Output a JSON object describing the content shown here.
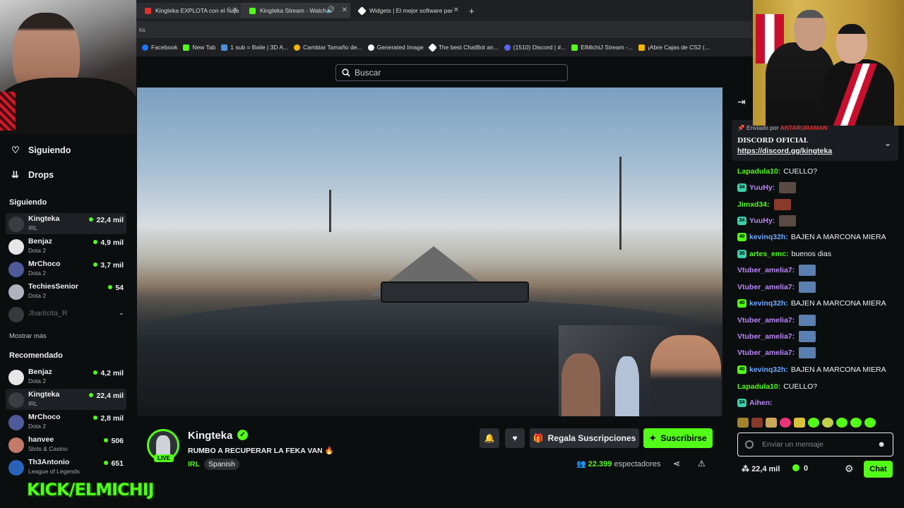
{
  "browser": {
    "tabs": [
      {
        "title": "Kingteka EXPLOTA con el Ñaja",
        "color": "#e0312d"
      },
      {
        "title": "Kingteka Stream - Watch L",
        "color": "#53fc18"
      },
      {
        "title": "Widgets | El mejor software par",
        "color": "#ffffff"
      }
    ],
    "address": "ka",
    "bookmarks": [
      {
        "label": "Facebook",
        "color": "#1877f2"
      },
      {
        "label": "New Tab",
        "color": "#53fc18"
      },
      {
        "label": "1 sub = Baile | 3D A...",
        "color": "#4a90d9"
      },
      {
        "label": "Cambiar Tamaño de...",
        "color": "#f4b400"
      },
      {
        "label": "Generated Image",
        "color": "#ffffff"
      },
      {
        "label": "The best ChatBot an...",
        "color": "#ffffff"
      },
      {
        "label": "(1510) Discord | #...",
        "color": "#5865f2"
      },
      {
        "label": "ElMichiJ Stream -...",
        "color": "#53fc18"
      },
      {
        "label": "¡Abre Cajas de CS2 (...",
        "color": "#f4b400"
      }
    ]
  },
  "header": {
    "search_placeholder": "Buscar"
  },
  "sidebar": {
    "nav": [
      {
        "label": "Siguiendo",
        "icon": "heart-icon"
      },
      {
        "label": "Drops",
        "icon": "drops-icon"
      }
    ],
    "following_title": "Siguiendo",
    "following": [
      {
        "name": "Kingteka",
        "category": "IRL",
        "viewers": "22,4 mil",
        "avatar_color": "#3a3d42",
        "live": true
      },
      {
        "name": "Benjaz",
        "category": "Dota 2",
        "viewers": "4,9 mil",
        "avatar_color": "#e6e6e6",
        "live": true
      },
      {
        "name": "MrChoco",
        "category": "Dota 2",
        "viewers": "3,7 mil",
        "avatar_color": "#4e5a9a",
        "live": true
      },
      {
        "name": "TechiesSenior",
        "category": "Dota 2",
        "viewers": "54",
        "avatar_color": "#b0b3bd",
        "live": true
      },
      {
        "name": "Jharitcita_R",
        "category": "",
        "viewers": "",
        "avatar_color": "#55585c",
        "live": false
      }
    ],
    "show_more": "Mostrar más",
    "recommended_title": "Recomendado",
    "recommended": [
      {
        "name": "Benjaz",
        "category": "Dota 2",
        "viewers": "4,2 mil",
        "avatar_color": "#e6e6e6"
      },
      {
        "name": "Kingteka",
        "category": "IRL",
        "viewers": "22,4 mil",
        "avatar_color": "#3a3d42"
      },
      {
        "name": "MrChoco",
        "category": "Dota 2",
        "viewers": "2,8 mil",
        "avatar_color": "#4e5a9a"
      },
      {
        "name": "hanvee",
        "category": "Slots & Casino",
        "viewers": "506",
        "avatar_color": "#c27a6a"
      },
      {
        "name": "Th3Antonio",
        "category": "League of Legends",
        "viewers": "651",
        "avatar_color": "#2a62b8"
      }
    ],
    "brand_overlay": "KICK/ELMICHIJ"
  },
  "stream": {
    "name": "Kingteka",
    "title": "RUMBO A RECUPERAR LA FEKA VAN 🔥",
    "category": "IRL",
    "language": "Spanish",
    "live_label": "LIVE",
    "gift_label": "Regala Suscripciones",
    "subscribe_label": "Suscribirse",
    "viewers_count": "22.399",
    "viewers_label": "espectadores"
  },
  "chat": {
    "pinned": {
      "by_label": "Enviado por",
      "by_user": "ANTARURAMAN",
      "title": "DISCORD OFICIAL",
      "link": "https://discord.gg/kingteka"
    },
    "messages": [
      {
        "badge": "",
        "user": "Lapadula10:",
        "user_color": "#53fc18",
        "text": "CUELLO?",
        "emote": ""
      },
      {
        "badge": "34",
        "badge_color": "#3ccfa8",
        "user": "YuuHy:",
        "user_color": "#b986f5",
        "text": "",
        "emote": "#5a4a44"
      },
      {
        "badge": "",
        "user": "Jimxd34:",
        "user_color": "#53fc18",
        "text": "",
        "emote": "#8a3a2a"
      },
      {
        "badge": "34",
        "badge_color": "#3ccfa8",
        "user": "YuuHy:",
        "user_color": "#b986f5",
        "text": "",
        "emote": "#5a4a44"
      },
      {
        "badge": "40",
        "badge_color": "#53fc18",
        "user": "kevinq32h:",
        "user_color": "#6fa8ff",
        "text": "BAJEN A MARCONA MIERA",
        "emote": ""
      },
      {
        "badge": "30",
        "badge_color": "#3ccfa8",
        "user": "artes_emc:",
        "user_color": "#53fc18",
        "text": "buenos dias",
        "emote": ""
      },
      {
        "badge": "",
        "user": "Vtuber_amelia7:",
        "user_color": "#b986f5",
        "text": "",
        "emote": "#5a7fb0"
      },
      {
        "badge": "",
        "user": "Vtuber_amelia7:",
        "user_color": "#b986f5",
        "text": "",
        "emote": "#5a7fb0"
      },
      {
        "badge": "40",
        "badge_color": "#53fc18",
        "user": "kevinq32h:",
        "user_color": "#6fa8ff",
        "text": "BAJEN A MARCONA MIERA",
        "emote": ""
      },
      {
        "badge": "",
        "user": "Vtuber_amelia7:",
        "user_color": "#b986f5",
        "text": "",
        "emote": "#5a7fb0"
      },
      {
        "badge": "",
        "user": "Vtuber_amelia7:",
        "user_color": "#b986f5",
        "text": "",
        "emote": "#5a7fb0"
      },
      {
        "badge": "",
        "user": "Vtuber_amelia7:",
        "user_color": "#b986f5",
        "text": "",
        "emote": "#5a7fb0"
      },
      {
        "badge": "40",
        "badge_color": "#53fc18",
        "user": "kevinq32h:",
        "user_color": "#6fa8ff",
        "text": "BAJEN A MARCONA MIERA",
        "emote": ""
      },
      {
        "badge": "",
        "user": "Lapadula10:",
        "user_color": "#53fc18",
        "text": "CUELLO?",
        "emote": ""
      },
      {
        "badge": "34",
        "badge_color": "#3ccfa8",
        "user": "Aihen:",
        "user_color": "#b986f5",
        "text": "",
        "emote": ""
      }
    ],
    "input_placeholder": "Enviar un mensaje",
    "points": "22,4 mil",
    "kicks": "0",
    "chat_button": "Chat"
  },
  "colors": {
    "accent": "#53fc18",
    "background": "#0b0e0f",
    "panel": "#1d2024"
  }
}
